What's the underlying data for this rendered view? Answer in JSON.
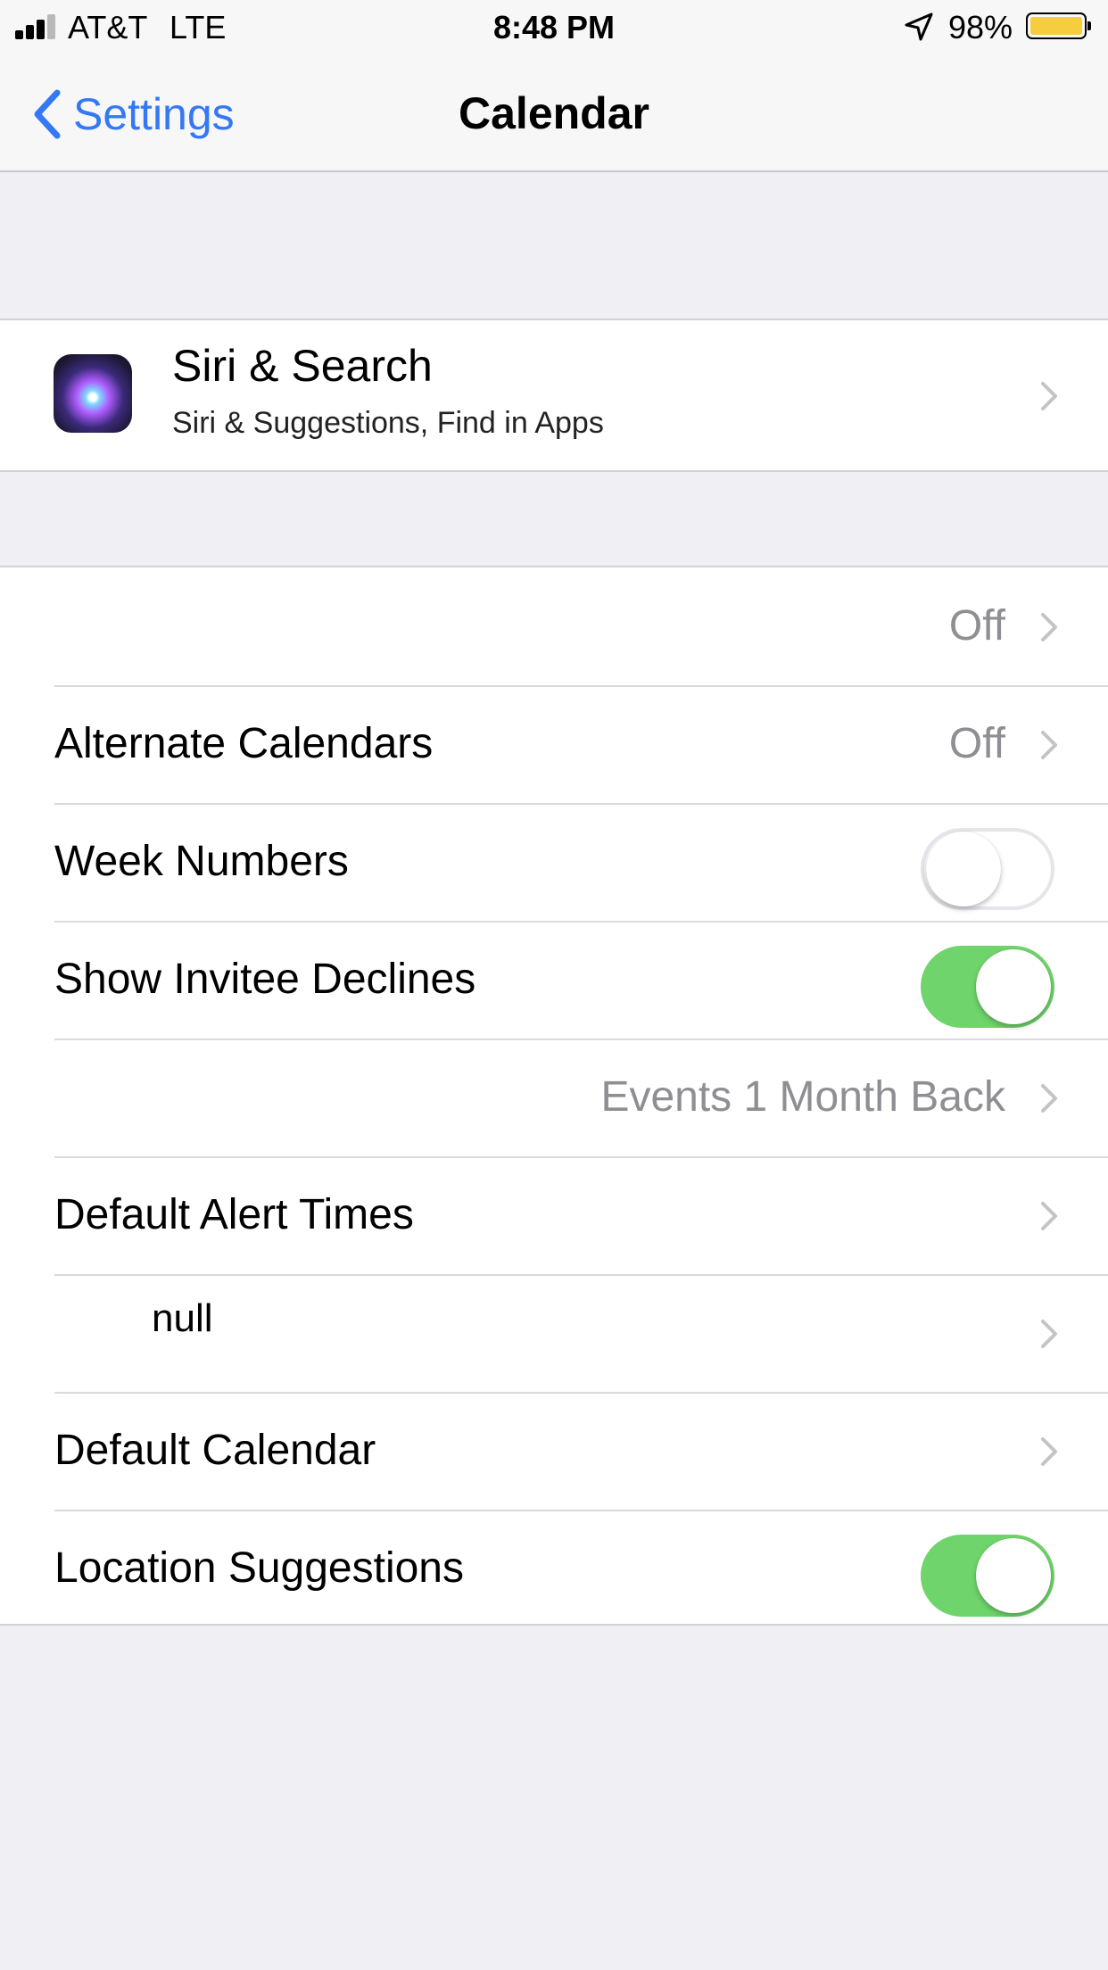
{
  "status_bar": {
    "carrier": "AT&T",
    "network": "LTE",
    "time": "8:48 PM",
    "battery_percent": "98%",
    "battery_level": 0.98,
    "battery_color": "#f5cd3d"
  },
  "nav": {
    "back_label": "Settings",
    "title": "Calendar"
  },
  "siri": {
    "title": "Siri & Search",
    "subtitle": "Siri & Suggestions, Find in Apps"
  },
  "rows": [
    {
      "label": "",
      "value": "Off",
      "control": "disclosure"
    },
    {
      "label": "Alternate Calendars",
      "value": "Off",
      "control": "disclosure"
    },
    {
      "label": "Week Numbers",
      "value": "",
      "control": "toggle",
      "on": false
    },
    {
      "label": "Show Invitee Declines",
      "value": "",
      "control": "toggle",
      "on": true
    },
    {
      "label": "",
      "value": "Events 1 Month Back",
      "control": "disclosure"
    },
    {
      "label": "Default Alert Times",
      "value": "",
      "control": "disclosure"
    },
    {
      "label": "null",
      "value": "",
      "control": "disclosure"
    },
    {
      "label": "Default Calendar",
      "value": "",
      "control": "disclosure"
    },
    {
      "label": "Location Suggestions",
      "value": "",
      "control": "toggle",
      "on": true
    }
  ],
  "colors": {
    "accent": "#3478f6",
    "toggle_on": "#6fd46b",
    "background": "#efeff4"
  }
}
